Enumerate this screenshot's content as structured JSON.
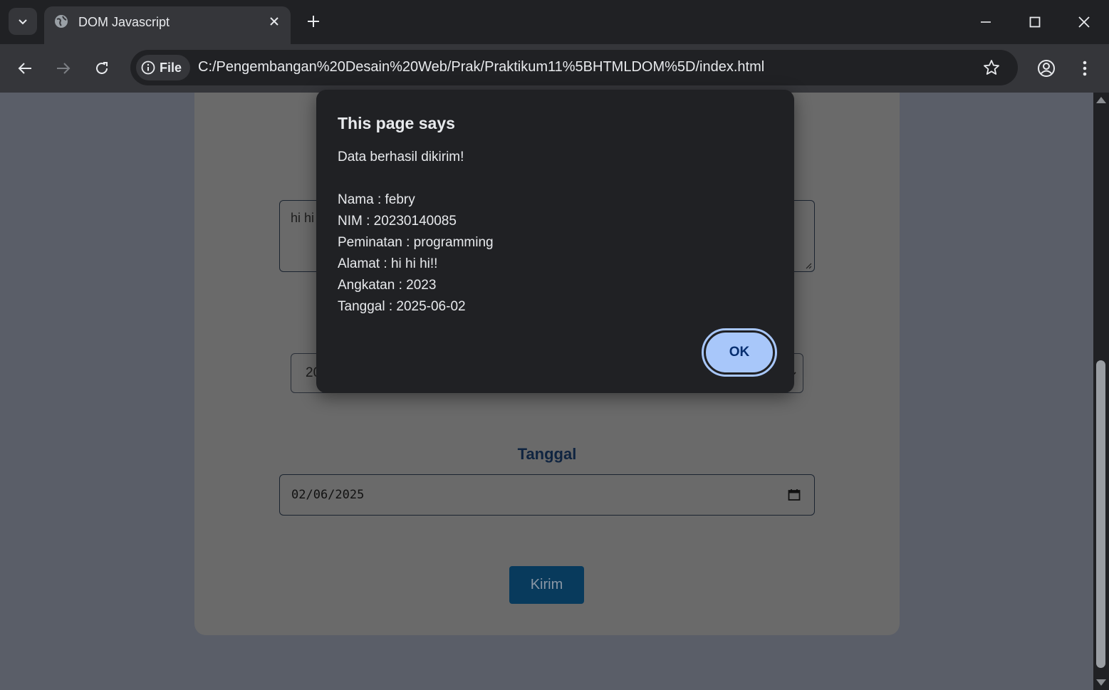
{
  "browser": {
    "tab_title": "DOM Javascript",
    "site_chip_label": "File",
    "url": "C:/Pengembangan%20Desain%20Web/Prak/Praktikum11%5BHTMLDOM%5D/index.html"
  },
  "page": {
    "textarea_value": "hi hi",
    "select_value": "20",
    "tanggal_label": "Tanggal",
    "date_value": "02/06/2025",
    "submit_label": "Kirim"
  },
  "dialog": {
    "title": "This page says",
    "lines": [
      "Data berhasil dikirim!",
      "",
      "Nama : febry",
      "NIM : 20230140085",
      "Peminatan : programming",
      "Alamat : hi hi hi!!",
      "Angkatan : 2023",
      "Tanggal : 2025-06-02"
    ],
    "ok_label": "OK"
  },
  "colors": {
    "chrome_dark": "#202124",
    "chrome_toolbar": "#35363a",
    "ok_button": "#a8c7fa",
    "submit_button": "#083a5c"
  },
  "icons": [
    "tab-search-icon",
    "globe-icon",
    "close-icon",
    "plus-icon",
    "minimize-icon",
    "maximize-icon",
    "window-close-icon",
    "back-arrow-icon",
    "forward-arrow-icon",
    "reload-icon",
    "info-icon",
    "star-icon",
    "profile-icon",
    "kebab-menu-icon",
    "calendar-icon",
    "chevron-down-icon"
  ]
}
